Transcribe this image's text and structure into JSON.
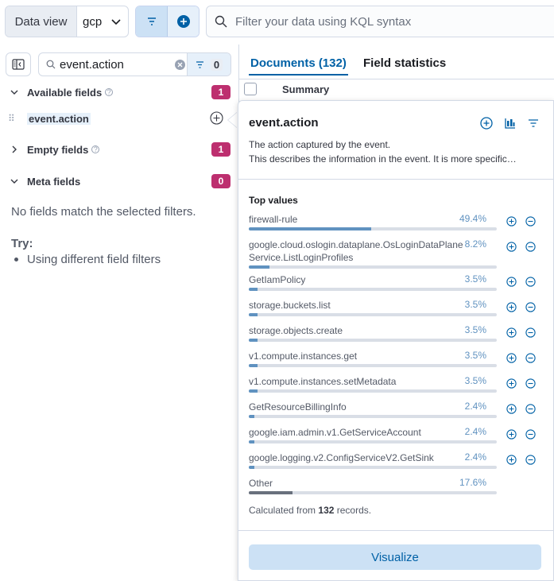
{
  "topbar": {
    "data_view_label": "Data view",
    "data_view_value": "gcp",
    "kql_placeholder": "Filter your data using KQL syntax"
  },
  "sidebar": {
    "search_value": "event.action",
    "filter_count": "0",
    "available": {
      "title": "Available fields",
      "count": "1"
    },
    "field": "event.action",
    "empty": {
      "title": "Empty fields",
      "count": "1"
    },
    "meta": {
      "title": "Meta fields",
      "count": "0"
    },
    "no_match": "No fields match the selected filters.",
    "try_title": "Try:",
    "try_item": "Using different field filters"
  },
  "main": {
    "tab_documents": "Documents (132)",
    "tab_stats": "Field statistics",
    "summary_header": "Summary"
  },
  "popover": {
    "title": "event.action",
    "desc_line1": "The action captured by the event.",
    "desc_line2": "This describes the information in the event. It is more specific…",
    "top_values_title": "Top values",
    "values": [
      {
        "label": "firewall-rule",
        "pct": "49.4%",
        "fraction": 0.494
      },
      {
        "label": "google.cloud.oslogin.dataplane.OsLoginDataPlaneService.ListLoginProfiles",
        "pct": "8.2%",
        "fraction": 0.082
      },
      {
        "label": "GetIamPolicy",
        "pct": "3.5%",
        "fraction": 0.035
      },
      {
        "label": "storage.buckets.list",
        "pct": "3.5%",
        "fraction": 0.035
      },
      {
        "label": "storage.objects.create",
        "pct": "3.5%",
        "fraction": 0.035
      },
      {
        "label": "v1.compute.instances.get",
        "pct": "3.5%",
        "fraction": 0.035
      },
      {
        "label": "v1.compute.instances.setMetadata",
        "pct": "3.5%",
        "fraction": 0.035
      },
      {
        "label": "GetResourceBillingInfo",
        "pct": "2.4%",
        "fraction": 0.024
      },
      {
        "label": "google.iam.admin.v1.GetServiceAccount",
        "pct": "2.4%",
        "fraction": 0.024
      },
      {
        "label": "google.logging.v2.ConfigServiceV2.GetSink",
        "pct": "2.4%",
        "fraction": 0.024
      }
    ],
    "other": {
      "label": "Other",
      "pct": "17.6%",
      "fraction": 0.176
    },
    "calc_prefix": "Calculated from",
    "calc_count": "132",
    "calc_suffix": "records.",
    "visualize_label": "Visualize"
  },
  "colors": {
    "accent": "#0061a6",
    "badge": "#bd2f6f",
    "bar": "#6092c0"
  }
}
